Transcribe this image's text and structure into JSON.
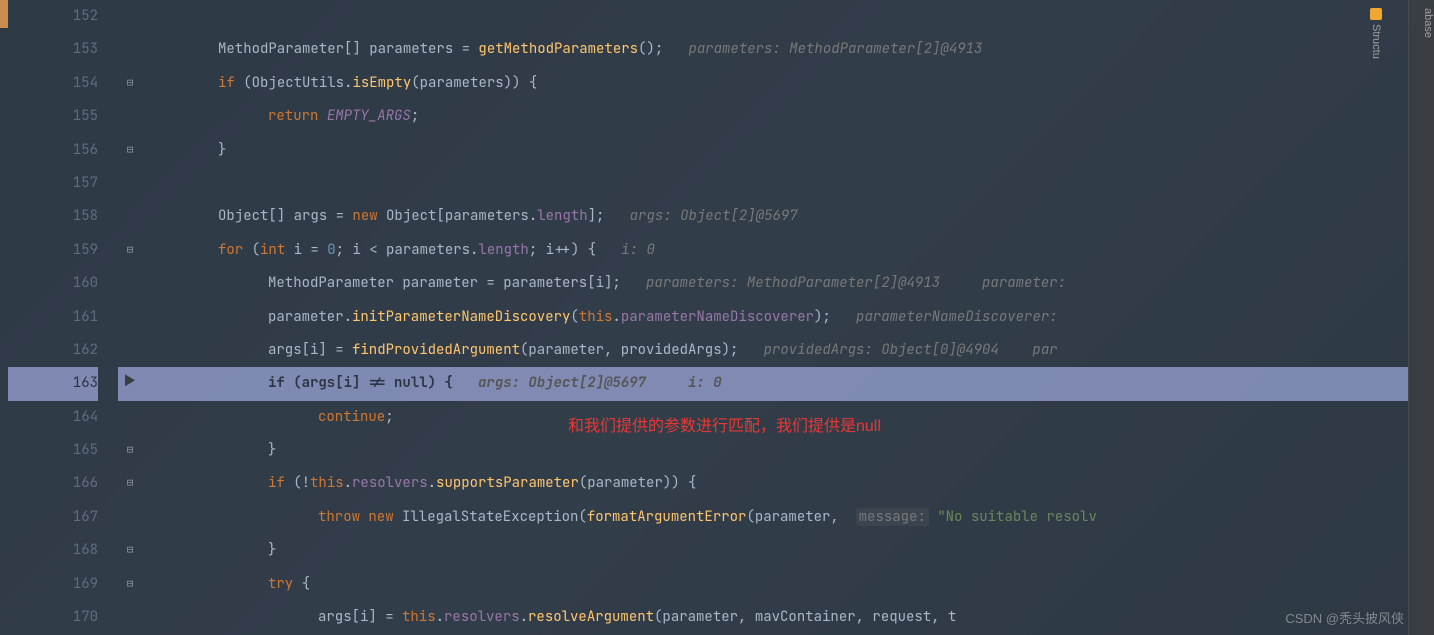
{
  "line_numbers": [
    "152",
    "153",
    "154",
    "155",
    "156",
    "157",
    "158",
    "159",
    "160",
    "161",
    "162",
    "163",
    "164",
    "165",
    "166",
    "167",
    "168",
    "169",
    "170"
  ],
  "highlighted_line": "163",
  "code": {
    "l153": {
      "type": "MethodParameter",
      "brackets": "[]",
      "var": "parameters",
      "eq": " = ",
      "call": "getMethodParameters",
      "hint": "parameters: MethodParameter[2]@4913"
    },
    "l154": {
      "kw": "if",
      "open": " (",
      "cls": "ObjectUtils",
      "dot": ".",
      "method": "isEmpty",
      "args": "(parameters)) {"
    },
    "l155": {
      "kw": "return",
      "const": "EMPTY_ARGS",
      "end": ";"
    },
    "l156": {
      "brace": "}"
    },
    "l158": {
      "type": "Object",
      "brackets": "[]",
      "var": " args = ",
      "kw": "new",
      "type2": " Object",
      "args": "[parameters.",
      "field": "length",
      "end": "];",
      "hint": "args: Object[2]@5697"
    },
    "l159": {
      "kw": "for",
      "open": " (",
      "kw2": "int",
      "var": " i = ",
      "num": "0",
      "cond": "; i < parameters.",
      "field": "length",
      "cond2": "; i++) {",
      "hint": "i: 0"
    },
    "l160": {
      "type": "MethodParameter",
      "var": " parameter = parameters[i];",
      "hint1": "parameters: MethodParameter[2]@4913",
      "hint2": "parameter:"
    },
    "l161": {
      "var": "parameter.",
      "method": "initParameterNameDiscovery",
      "args": "(",
      "kw": "this",
      "dot": ".",
      "field": "parameterNameDiscoverer",
      "end": ");",
      "hint": "parameterNameDiscoverer:"
    },
    "l162": {
      "var": "args[i] = ",
      "method": "findProvidedArgument",
      "args": "(parameter, providedArgs);",
      "hint1": "providedArgs: Object[0]@4904",
      "hint2": "par"
    },
    "l163": {
      "kw": "if",
      "cond": " (args[i] != ",
      "kw2": "null",
      "end": ") {",
      "hint1": "args: Object[2]@5697",
      "hint2": "i: 0"
    },
    "l164": {
      "kw": "continue",
      "end": ";"
    },
    "l165": {
      "brace": "}"
    },
    "l166": {
      "kw": "if",
      "open": " (!",
      "kw2": "this",
      "dot": ".",
      "field": "resolvers",
      "dot2": ".",
      "method": "supportsParameter",
      "args": "(parameter)) {"
    },
    "l167": {
      "kw": "throw",
      "kw2": "new",
      "type": " IllegalStateException",
      "open": "(",
      "method": "formatArgumentError",
      "args": "(parameter, ",
      "label": "message:",
      "str": " \"No suitable resolv"
    },
    "l168": {
      "brace": "}"
    },
    "l169": {
      "kw": "try",
      "brace": " {"
    },
    "l170": {
      "var": "args[i] = ",
      "kw": "this",
      "dot": ".",
      "field": "resolvers",
      "dot2": ".",
      "method": "resolveArgument",
      "args": "(parameter, mavContainer, request, t"
    }
  },
  "annotation": "和我们提供的参数进行匹配，我们提供是null",
  "sidebar": {
    "database": "abase",
    "structure": "Structu"
  },
  "watermark": "CSDN @秃头披风侠"
}
